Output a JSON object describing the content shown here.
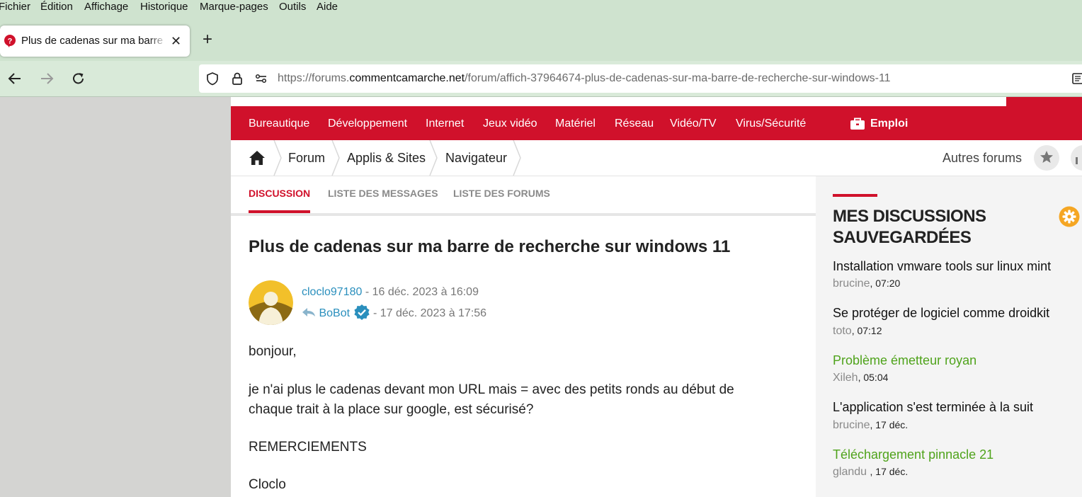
{
  "menu": [
    "Fichier",
    "Édition",
    "Affichage",
    "Historique",
    "Marque-pages",
    "Outils",
    "Aide"
  ],
  "tab": {
    "title": "Plus de cadenas sur ma barre de recherche sur windows 11",
    "close": "✕"
  },
  "newtab": "+",
  "url": {
    "prefix": "https://forums.",
    "domain": "commentcamarche.net",
    "path": "/forum/affich-37964674-plus-de-cadenas-sur-ma-barre-de-recherche-sur-windows-11"
  },
  "categories": [
    "Bureautique",
    "Développement",
    "Internet",
    "Jeux vidéo",
    "Matériel",
    "Réseau",
    "Vidéo/TV",
    "Virus/Sécurité"
  ],
  "emploi": "Emploi",
  "breadcrumb": [
    "Forum",
    "Applis & Sites",
    "Navigateur"
  ],
  "autres_forums": "Autres forums",
  "page_tabs": [
    "DISCUSSION",
    "LISTE DES MESSAGES",
    "LISTE DES FORUMS"
  ],
  "post": {
    "title": "Plus de cadenas sur ma barre de recherche sur windows 11",
    "author": "cloclo97180",
    "author_date": " - 16 déc. 2023 à 16:09",
    "reply_user": "BoBot",
    "reply_date": " - 17 déc. 2023 à 17:56",
    "body": [
      "bonjour,",
      "je n'ai plus le cadenas devant mon URL mais = avec des petits ronds au début de",
      "chaque trait à la place sur google, est sécurisé?",
      "REMERCIEMENTS",
      "Cloclo"
    ]
  },
  "sidebar": {
    "title_line1": "MES DISCUSSIONS",
    "title_line2": "SAUVEGARDÉES",
    "items": [
      {
        "title": "Installation vmware tools sur linux mint",
        "user": "brucine",
        "time": ", 07:20",
        "green": false
      },
      {
        "title": "Se protéger de logiciel comme droidkit",
        "user": "toto",
        "time": ", 07:12",
        "green": false
      },
      {
        "title": "Problème émetteur royan",
        "user": "Xileh",
        "time": ", 05:04",
        "green": true
      },
      {
        "title": "L'application s'est terminée à la suit",
        "user": "brucine",
        "time": ", 17 déc.",
        "green": false
      },
      {
        "title": "Téléchargement pinnacle 21",
        "user": "glandu ",
        "time": ", 17 déc.",
        "green": true
      }
    ]
  },
  "colors": {
    "brand_red": "#d0112b",
    "link_blue": "#2a8fbd",
    "green": "#4fa31b",
    "gear_orange": "#f5a623"
  }
}
